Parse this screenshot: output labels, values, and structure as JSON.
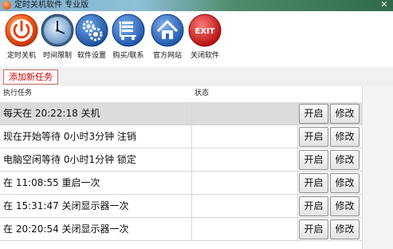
{
  "window": {
    "title": "定时关机软件 专业版",
    "close_glyph": "✕"
  },
  "toolbar": {
    "items": [
      {
        "label": "定时关机",
        "icon": "power-icon",
        "color": "#e8421a"
      },
      {
        "label": "时间限制",
        "icon": "clock-icon",
        "color": "#3a6fb8"
      },
      {
        "label": "软件设置",
        "icon": "gears-icon",
        "color": "#1f5fb4"
      },
      {
        "label": "购买/联系",
        "icon": "cart-icon",
        "color": "#2a62c0"
      },
      {
        "label": "官方网站",
        "icon": "home-icon",
        "color": "#2a62c0"
      },
      {
        "label": "关闭软件",
        "icon": "exit-icon",
        "color": "#d81e1e"
      }
    ],
    "exit_text": "EXIT"
  },
  "add_task_label": "添加新任务",
  "table": {
    "headers": {
      "task": "执行任务",
      "status": "状态"
    },
    "start_label": "开启",
    "edit_label": "修改",
    "rows": [
      {
        "task": "每天在 20:22:18 关机",
        "status": "",
        "selected": true
      },
      {
        "task": "现在开始等待 0小时3分钟 注销",
        "status": "",
        "selected": false
      },
      {
        "task": "电脑空闲等待 0小时1分钟 锁定",
        "status": "",
        "selected": false
      },
      {
        "task": "在 11:08:55 重启一次",
        "status": "",
        "selected": false
      },
      {
        "task": "在 15:31:47 关闭显示器一次",
        "status": "",
        "selected": false
      },
      {
        "task": "在 20:20:54 关闭显示器一次",
        "status": "",
        "selected": false
      }
    ]
  }
}
